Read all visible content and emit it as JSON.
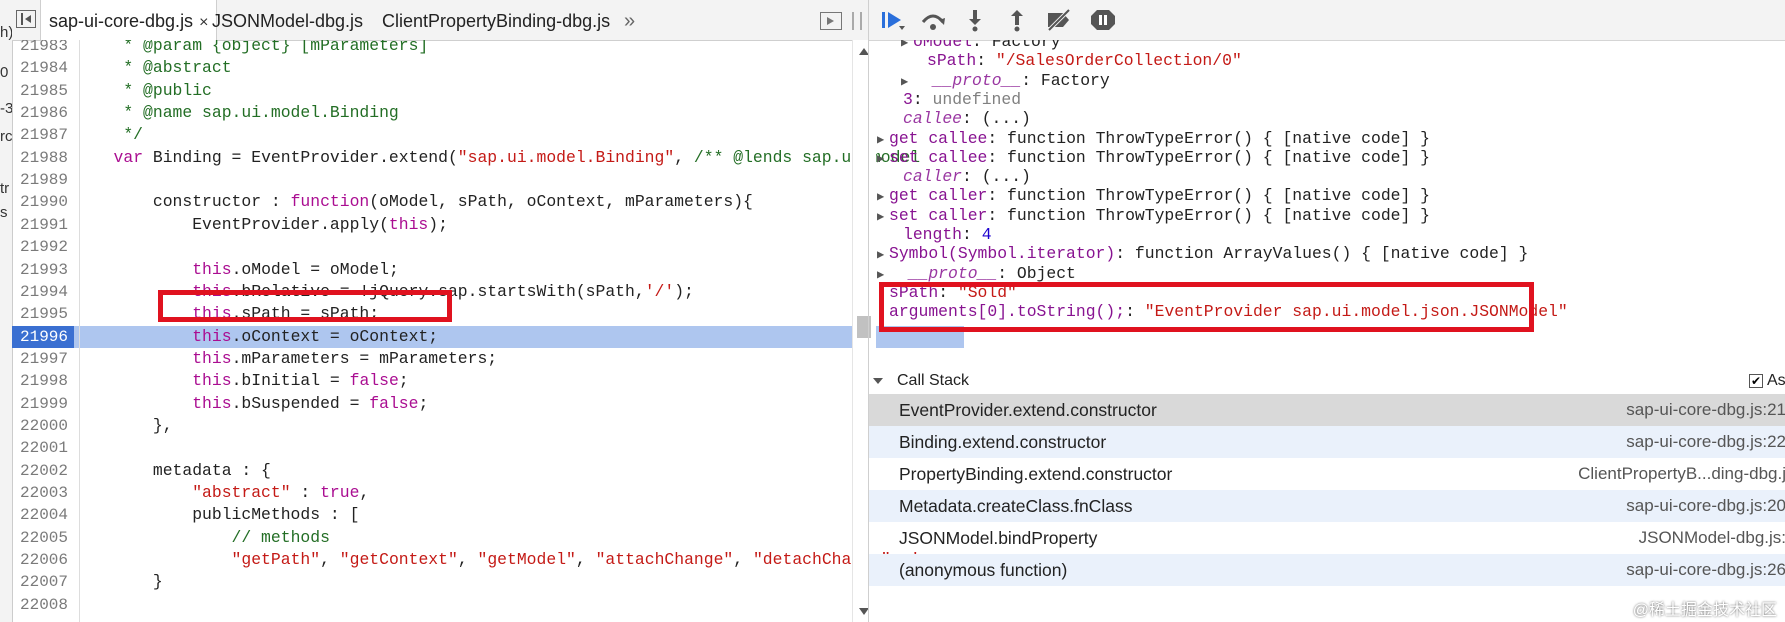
{
  "left_strip": {
    "fragments": [
      "h)",
      "0",
      "-3",
      "rc",
      "tr",
      "s"
    ]
  },
  "tabs": [
    {
      "label": "sap-ui-core-dbg.js",
      "close": "×",
      "active": true
    },
    {
      "label": "JSONModel-dbg.js"
    },
    {
      "label": "ClientPropertyBinding-dbg.js"
    }
  ],
  "tab_more": "»",
  "code_lines": [
    {
      "n": "21983",
      "t": "    * @param {object} [mParameters]",
      "kind": "comment"
    },
    {
      "n": "21984",
      "t": "    * @abstract",
      "kind": "comment"
    },
    {
      "n": "21985",
      "t": "    * @public",
      "kind": "comment"
    },
    {
      "n": "21986",
      "t": "    * @name sap.ui.model.Binding",
      "kind": "comment"
    },
    {
      "n": "21987",
      "t": "    */",
      "kind": "comment"
    },
    {
      "n": "21988",
      "t": "   var Binding = EventProvider.extend(\"sap.ui.model.Binding\", /** @lends sap.ui.model",
      "kind": "code"
    },
    {
      "n": "21989",
      "t": "",
      "kind": "code"
    },
    {
      "n": "21990",
      "t": "       constructor : function(oModel, sPath, oContext, mParameters){",
      "kind": "code"
    },
    {
      "n": "21991",
      "t": "           EventProvider.apply(this);",
      "kind": "code"
    },
    {
      "n": "21992",
      "t": "",
      "kind": "code"
    },
    {
      "n": "21993",
      "t": "           this.oModel = oModel;",
      "kind": "code"
    },
    {
      "n": "21994",
      "t": "           this.bRelative = !jQuery.sap.startsWith(sPath,'/');",
      "kind": "code"
    },
    {
      "n": "21995",
      "t": "           this.sPath = sPath;",
      "kind": "code"
    },
    {
      "n": "21996",
      "t": "           this.oContext = oContext;",
      "kind": "code",
      "current": true
    },
    {
      "n": "21997",
      "t": "           this.mParameters = mParameters;",
      "kind": "code"
    },
    {
      "n": "21998",
      "t": "           this.bInitial = false;",
      "kind": "code"
    },
    {
      "n": "21999",
      "t": "           this.bSuspended = false;",
      "kind": "code"
    },
    {
      "n": "22000",
      "t": "       },",
      "kind": "code"
    },
    {
      "n": "22001",
      "t": "",
      "kind": "code"
    },
    {
      "n": "22002",
      "t": "       metadata : {",
      "kind": "code"
    },
    {
      "n": "22003",
      "t": "           \"abstract\" : true,",
      "kind": "code"
    },
    {
      "n": "22004",
      "t": "           publicMethods : [",
      "kind": "code"
    },
    {
      "n": "22005",
      "t": "               // methods",
      "kind": "code"
    },
    {
      "n": "22006",
      "t": "               \"getPath\", \"getContext\", \"getModel\", \"attachChange\", \"detachChange\", '",
      "kind": "code"
    },
    {
      "n": "22007",
      "t": "       }",
      "kind": "code"
    },
    {
      "n": "22008",
      "t": "",
      "kind": "code"
    }
  ],
  "scope_lines": [
    {
      "indent": 2,
      "tri": "▶",
      "html_parts": [
        [
          "k",
          "oModel"
        ],
        [
          "p",
          ": Factory"
        ]
      ]
    },
    {
      "indent": 3,
      "tri": "",
      "html_parts": [
        [
          "k",
          "sPath"
        ],
        [
          "p",
          ": "
        ],
        [
          "s",
          "\"/SalesOrderCollection/0\""
        ]
      ]
    },
    {
      "indent": 2,
      "tri": "▶",
      "html_parts": [
        [
          "k2",
          "  __proto__"
        ],
        [
          "p",
          ": Factory"
        ]
      ]
    },
    {
      "indent": 1,
      "tri": "",
      "html_parts": [
        [
          "k",
          "3"
        ],
        [
          "p",
          ": "
        ],
        [
          "u",
          "undefined"
        ]
      ]
    },
    {
      "indent": 1,
      "tri": "",
      "html_parts": [
        [
          "k2",
          "callee"
        ],
        [
          "p",
          ": (...)"
        ]
      ]
    },
    {
      "indent": 0,
      "tri": "▶",
      "html_parts": [
        [
          "k",
          "get callee"
        ],
        [
          "p",
          ": function ThrowTypeError() { [native code] }"
        ]
      ]
    },
    {
      "indent": 0,
      "tri": "▶",
      "html_parts": [
        [
          "k",
          "set callee"
        ],
        [
          "p",
          ": function ThrowTypeError() { [native code] }"
        ]
      ]
    },
    {
      "indent": 1,
      "tri": "",
      "html_parts": [
        [
          "k2",
          "caller"
        ],
        [
          "p",
          ": (...)"
        ]
      ]
    },
    {
      "indent": 0,
      "tri": "▶",
      "html_parts": [
        [
          "k",
          "get caller"
        ],
        [
          "p",
          ": function ThrowTypeError() { [native code] }"
        ]
      ]
    },
    {
      "indent": 0,
      "tri": "▶",
      "html_parts": [
        [
          "k",
          "set caller"
        ],
        [
          "p",
          ": function ThrowTypeError() { [native code] }"
        ]
      ]
    },
    {
      "indent": 1,
      "tri": "",
      "html_parts": [
        [
          "k",
          "length"
        ],
        [
          "p",
          ": "
        ],
        [
          "n",
          "4"
        ]
      ]
    },
    {
      "indent": 0,
      "tri": "▶",
      "html_parts": [
        [
          "k",
          "Symbol(Symbol.iterator)"
        ],
        [
          "p",
          ": function ArrayValues() { [native code] }"
        ]
      ]
    },
    {
      "indent": 0,
      "tri": "▶",
      "html_parts": [
        [
          "k2",
          "  __proto__"
        ],
        [
          "p",
          ": Object"
        ]
      ]
    },
    {
      "indent": -1,
      "tri": "",
      "html_parts": [
        [
          "k",
          "sPath"
        ],
        [
          "p",
          ": "
        ],
        [
          "s",
          "\"Sold\""
        ]
      ]
    },
    {
      "indent": -1,
      "tri": "",
      "html_parts": [
        [
          "k",
          "arguments[0].toString();"
        ],
        [
          "p",
          ": "
        ],
        [
          "s",
          "\"EventProvider sap.ui.model.json.JSONModel\""
        ]
      ]
    }
  ],
  "callstack": {
    "title": "Call Stack",
    "async_label": "As",
    "frames": [
      {
        "fn": "EventProvider.extend.constructor",
        "loc": "sap-ui-core-dbg.js:21"
      },
      {
        "fn": "Binding.extend.constructor",
        "loc": "sap-ui-core-dbg.js:22"
      },
      {
        "fn": "PropertyBinding.extend.constructor",
        "loc": "ClientPropertyB...ding-dbg.j"
      },
      {
        "fn": "Metadata.createClass.fnClass",
        "loc": "sap-ui-core-dbg.js:20"
      },
      {
        "fn": "JSONModel.bindProperty",
        "loc": "JSONModel-dbg.js:"
      },
      {
        "fn": "(anonymous function)",
        "loc": "sap-ui-core-dbg.js:26"
      }
    ]
  },
  "watermark": "@稀土掘金技术社区",
  "colors": {
    "highlight": "#aec6ef",
    "current_line_number": "#3a6fd1",
    "annotation_red": "#e0121f"
  }
}
